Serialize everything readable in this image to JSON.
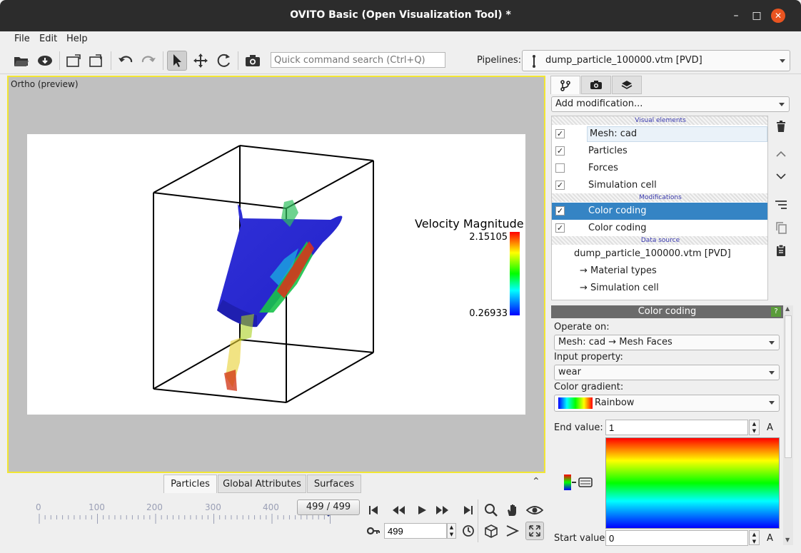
{
  "window": {
    "title": "OVITO Basic (Open Visualization Tool) *"
  },
  "menu": [
    "File",
    "Edit",
    "Help"
  ],
  "toolbar": {
    "search_placeholder": "Quick command search (Ctrl+Q)",
    "pipelines_label": "Pipelines:",
    "pipeline_value": "dump_particle_100000.vtm [PVD]"
  },
  "viewport": {
    "label": "Ortho (preview)",
    "legend_title": "Velocity Magnitude",
    "legend_max": "2.15105",
    "legend_min": "0.26933"
  },
  "bottom_tabs": [
    "Particles",
    "Global Attributes",
    "Surfaces"
  ],
  "timeline": {
    "ticks": [
      "0",
      "100",
      "200",
      "300",
      "400"
    ],
    "frame_indicator": "499 / 499",
    "current_frame": "499"
  },
  "pipeline_editor": {
    "add_modification": "Add modification...",
    "visual_elements_header": "Visual elements",
    "visual_elements": [
      {
        "label": "Mesh: cad",
        "checked": true
      },
      {
        "label": "Particles",
        "checked": true
      },
      {
        "label": "Forces",
        "checked": false
      },
      {
        "label": "Simulation cell",
        "checked": true
      }
    ],
    "modifications_header": "Modifications",
    "modifications": [
      {
        "label": "Color coding",
        "checked": true,
        "selected": true
      },
      {
        "label": "Color coding",
        "checked": true,
        "selected": false
      }
    ],
    "data_source_header": "Data source",
    "data_source": "dump_particle_100000.vtm [PVD]",
    "data_source_children": [
      "→ Material types",
      "→ Simulation cell"
    ]
  },
  "color_coding": {
    "title": "Color coding",
    "help": "?",
    "operate_on_label": "Operate on:",
    "operate_on_value": "Mesh: cad → Mesh Faces",
    "input_property_label": "Input property:",
    "input_property_value": "wear",
    "color_gradient_label": "Color gradient:",
    "color_gradient_value": "Rainbow",
    "end_value_label": "End value:",
    "end_value": "1",
    "start_value_label": "Start value:",
    "start_value": "0",
    "animate_label": "A"
  },
  "colors": {
    "accent": "#3584c4",
    "viewport_border": "#f2e633",
    "titlebar": "#2c2c2c",
    "close_button": "#e95420"
  }
}
